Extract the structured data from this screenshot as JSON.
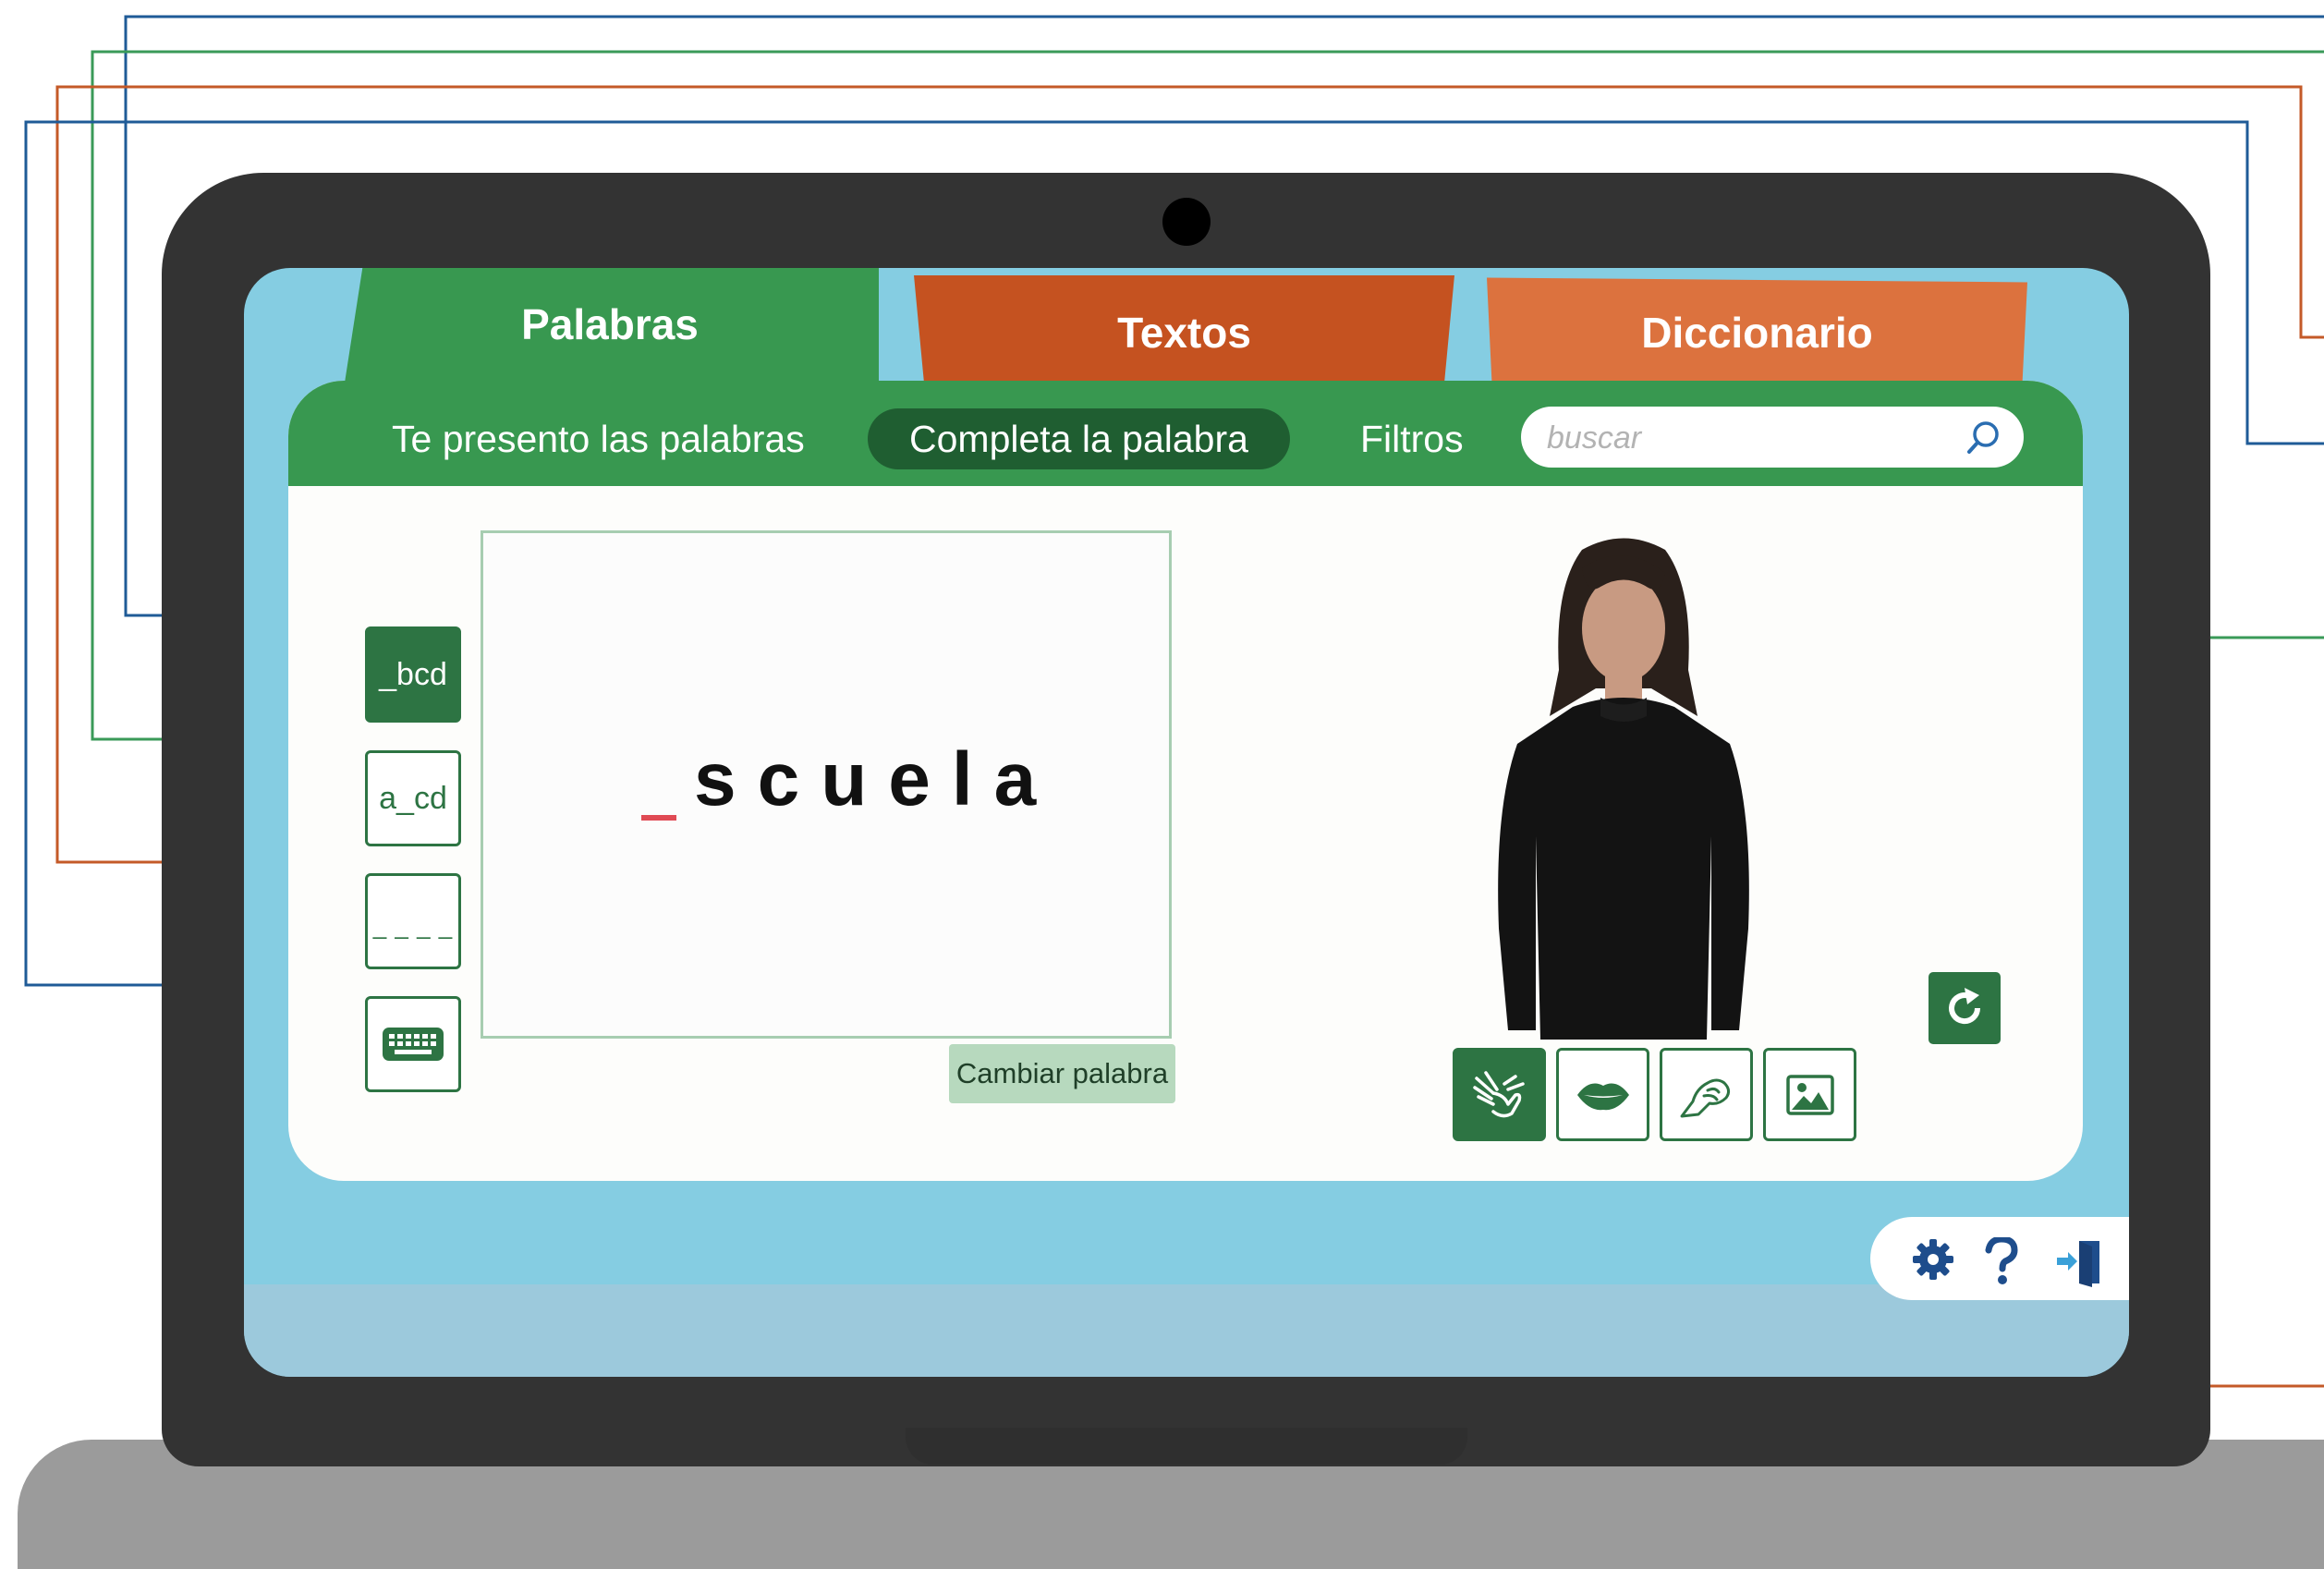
{
  "tabs": [
    {
      "label": "Palabras",
      "active": true
    },
    {
      "label": "Textos",
      "active": false
    },
    {
      "label": "Diccionario",
      "active": false
    }
  ],
  "subnav": {
    "intro_label": "Te presento las palabras",
    "complete_label": "Completa la palabra",
    "filters_label": "Filtros",
    "search_placeholder": "buscar"
  },
  "hint_modes": [
    {
      "label": "_bcd",
      "active": true
    },
    {
      "label": "a_cd",
      "active": false
    },
    {
      "label": "_ _ _ _",
      "active": false
    },
    {
      "icon": "keyboard-icon",
      "active": false
    }
  ],
  "exercise": {
    "word_remainder": "scuela",
    "missing_letters": 1,
    "change_word_label": "Cambiar palabra"
  },
  "media_modes": [
    {
      "icon": "sign-language-hands-icon",
      "active": true
    },
    {
      "icon": "lips-icon",
      "active": false
    },
    {
      "icon": "fingerspelling-hand-icon",
      "active": false
    },
    {
      "icon": "image-icon",
      "active": false
    }
  ],
  "utilities": [
    "gear-icon",
    "help-icon",
    "exit-door-icon"
  ],
  "colors": {
    "green": "#389850",
    "dark_green": "#2d7443",
    "orange_dark": "#c55220",
    "orange": "#dc723e",
    "blue_callout": "#1f5b97",
    "screen_bg": "#85cde2",
    "blank_marker": "#e04a54"
  }
}
